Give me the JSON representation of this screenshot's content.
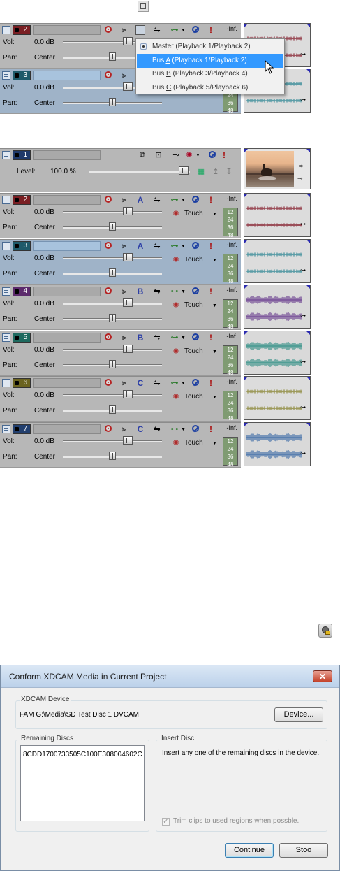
{
  "top_icon": "bus-assign-icon",
  "top_tracks": [
    {
      "num": "2",
      "color": "#7a1f23",
      "vol_label": "Vol:",
      "vol": "0.0 dB",
      "pan_label": "Pan:",
      "pan": "Center",
      "meter": [
        "-Inf.",
        "12",
        "24",
        "36",
        "48"
      ],
      "selected": false
    },
    {
      "num": "3",
      "color": "#1e5a6a",
      "vol_label": "Vol:",
      "vol": "0.0 dB",
      "pan_label": "Pan:",
      "pan": "Center",
      "meter": [
        "-Inf.",
        "12",
        "24",
        "36",
        "48"
      ],
      "selected": true
    }
  ],
  "bus_menu": {
    "items": [
      {
        "label": "Master (Playback 1/Playback 2)",
        "highlighted": false,
        "checked": true
      },
      {
        "pre": "Bus ",
        "u": "A",
        "post": " (Playback 1/Playback 2)",
        "highlighted": true
      },
      {
        "pre": "Bus ",
        "u": "B",
        "post": " (Playback 3/Playback 4)",
        "highlighted": false
      },
      {
        "pre": "Bus ",
        "u": "C",
        "post": " (Playback 5/Playback 6)",
        "highlighted": false
      }
    ]
  },
  "video_track": {
    "num": "1",
    "level_label": "Level:",
    "level": "100.0 %"
  },
  "tracks": [
    {
      "num": "2",
      "color": "#7a1f23",
      "bus": "A",
      "vol_label": "Vol:",
      "vol": "0.0 dB",
      "pan_label": "Pan:",
      "pan": "Center",
      "mode": "Touch",
      "meter": [
        "-Inf.",
        "12",
        "24",
        "36",
        "48"
      ],
      "selected": false,
      "wave": "#8b2a38",
      "dense": false
    },
    {
      "num": "3",
      "color": "#1e5a6a",
      "bus": "A",
      "vol_label": "Vol:",
      "vol": "0.0 dB",
      "pan_label": "Pan:",
      "pan": "Center",
      "mode": "Touch",
      "meter": [
        "-Inf.",
        "12",
        "24",
        "36",
        "48"
      ],
      "selected": true,
      "wave": "#3c8d9a",
      "dense": false
    },
    {
      "num": "4",
      "color": "#5c2a6c",
      "bus": "B",
      "vol_label": "Vol:",
      "vol": "0.0 dB",
      "pan_label": "Pan:",
      "pan": "Center",
      "mode": "Touch",
      "meter": [
        "-Inf.",
        "12",
        "24",
        "36",
        "48"
      ],
      "selected": false,
      "wave": "#6a3d8f",
      "dense": true
    },
    {
      "num": "5",
      "color": "#1e6a5f",
      "bus": "B",
      "vol_label": "Vol:",
      "vol": "0.0 dB",
      "pan_label": "Pan:",
      "pan": "Center",
      "mode": "Touch",
      "meter": [
        "-Inf.",
        "12",
        "24",
        "36",
        "48"
      ],
      "selected": false,
      "wave": "#2f8f85",
      "dense": true
    },
    {
      "num": "6",
      "color": "#6b6320",
      "bus": "C",
      "vol_label": "Vol:",
      "vol": "0.0 dB",
      "pan_label": "Pan:",
      "pan": "Center",
      "mode": "Touch",
      "meter": [
        "-Inf.",
        "12",
        "24",
        "36",
        "48"
      ],
      "selected": false,
      "wave": "#8d8a3c",
      "dense": false
    },
    {
      "num": "7",
      "color": "#223f6e",
      "bus": "C",
      "vol_label": "Vol:",
      "vol": "0.0 dB",
      "pan_label": "Pan:",
      "pan": "Center",
      "mode": "Touch",
      "meter": [
        "-Inf.",
        "12",
        "24",
        "36",
        "48"
      ],
      "selected": false,
      "wave": "#3a6aa6",
      "dense": true
    }
  ],
  "standalone_icon": "xdcam-icon",
  "dialog": {
    "title": "Conform XDCAM Media in Current Project",
    "close": "✕",
    "device_group": "XDCAM Device",
    "device_text": "FAM G:\\Media\\SD Test Disc 1 DVCAM",
    "device_button": "Device...",
    "remaining_label": "Remaining Discs",
    "remaining_items": [
      "8CDD1700733505C100E308004602C"
    ],
    "insert_label": "Insert Disc",
    "insert_text": "Insert any one of the remaining discs in the device.",
    "trim_label": "Trim clips to used regions when possble.",
    "continue_button": "Continue",
    "stop_button": "Stoo"
  }
}
